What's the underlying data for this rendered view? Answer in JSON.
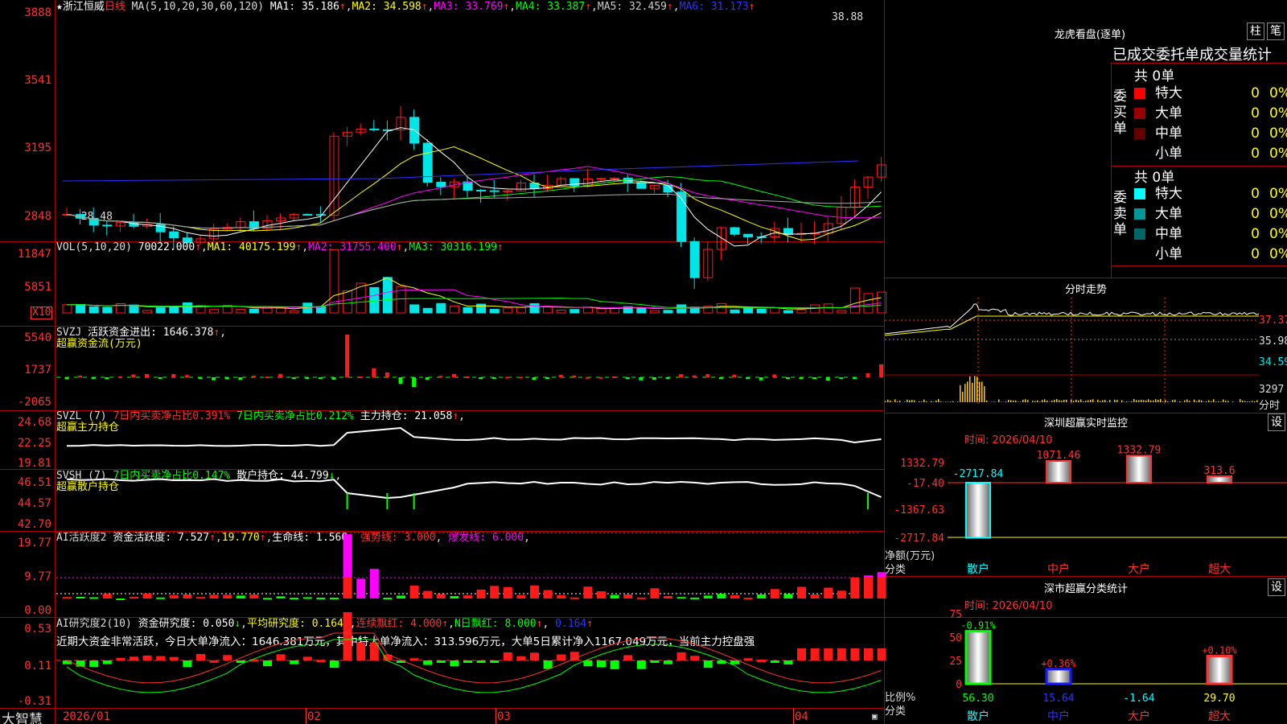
{
  "colors": {
    "up": "#ff1a1a",
    "down": "#00e6e6",
    "grid": "#aa0000",
    "yellow": "#ffff00",
    "magenta": "#ff00ff",
    "green": "#00ff00",
    "blue": "#3030ff"
  },
  "kline": {
    "title_star": "★浙江恒威",
    "period": "日线",
    "ma_label": "MA(5,10,20,30,60,120)",
    "ma1": "MA1: 35.186",
    "ma2": "MA2: 34.598",
    "ma3": "MA3: 33.769",
    "ma4": "MA4: 33.387",
    "ma5": "MA5: 32.459",
    "ma6": "MA6: 31.173",
    "arrow": "↑",
    "y_ticks": [
      "3888",
      "3541",
      "3195",
      "2848"
    ],
    "high_label": "38.88",
    "low_label": "←28.48"
  },
  "vol": {
    "label": "VOL(5,10,20)",
    "value": "70022.000",
    "ma1": "MA1: 40175.199",
    "ma2": "MA2: 31755.400",
    "ma3": "MA3: 30316.199",
    "y_ticks": [
      "11847",
      "5851"
    ],
    "unit": "X10"
  },
  "svzj": {
    "label": "SVZJ",
    "text": "活跃资金进出: 1646.378",
    "sub": "超赢资金流(万元)",
    "y_ticks": [
      "5540",
      "1737",
      "-2065"
    ]
  },
  "svzl": {
    "label": "SVZL (7)",
    "r1": "7日内买卖净占比0.391%",
    "r2": "7日内买卖净占比0.212%",
    "r3": "主力持仓: 21.058",
    "sub": "超赢主力持仓",
    "y_ticks": [
      "24.68",
      "22.25",
      "19.81"
    ]
  },
  "svsh": {
    "label": "SVSH (7)",
    "r1": "7日内买卖净占比0.147%",
    "r2": "散户持仓: 44.799",
    "sub": "超赢散户持仓",
    "y_ticks": [
      "46.51",
      "44.57",
      "42.70"
    ]
  },
  "ai1": {
    "label": "AI活跃度2",
    "t1": "资金活跃度: 7.527",
    "t2": "19.770",
    "t3": "生命线: 1.560",
    "t4": "强势线: 3.000",
    "t5": "爆发线: 6.000",
    "y_ticks": [
      "19.77",
      "9.77",
      "0.00"
    ]
  },
  "ai2": {
    "label": "AI研究度2(10)",
    "t1": "资金研究度: 0.050",
    "t2": "平均研究度: 0.164",
    "t3": "连续飘红: 4.000",
    "t4": "N日飘红: 8.000",
    "t5": "0.164",
    "summary": "近期大资金非常活跃，今日大单净流入：1646.381万元，其中特大单净流入：313.596万元，大单5日累计净入1167.049万元，当前主力控盘强",
    "y_ticks": [
      "0.53",
      "0.11",
      "-0.31"
    ]
  },
  "xaxis": {
    "brand": "大智慧",
    "dates": [
      "2026/01",
      "02",
      "03",
      "04"
    ]
  },
  "right": {
    "lhb_title": "龙虎看盘(逐单)",
    "btn_bar": "柱",
    "btn_tick": "笔",
    "stat_title": "已成交委托单成交量统计",
    "buy": {
      "side": "委买单",
      "total": "共 0单",
      "rows": [
        {
          "label": "特大",
          "v": "0",
          "p": "0%",
          "c": "#ff0000"
        },
        {
          "label": "大单",
          "v": "0",
          "p": "0%",
          "c": "#990000"
        },
        {
          "label": "中单",
          "v": "0",
          "p": "0%",
          "c": "#660000"
        },
        {
          "label": "小单",
          "v": "0",
          "p": "0%",
          "c": "#000000"
        }
      ]
    },
    "sell": {
      "side": "委卖单",
      "total": "共 0单",
      "rows": [
        {
          "label": "特大",
          "v": "0",
          "p": "0%",
          "c": "#00ffff"
        },
        {
          "label": "大单",
          "v": "0",
          "p": "0%",
          "c": "#009999"
        },
        {
          "label": "中单",
          "v": "0",
          "p": "0%",
          "c": "#006666"
        },
        {
          "label": "小单",
          "v": "0",
          "p": "0%",
          "c": "#000000"
        }
      ]
    },
    "intraday": {
      "title": "分时走势",
      "p1": "37.37",
      "p2": "35.98",
      "p3": "34.59",
      "vol": "3297",
      "unit": "分时"
    },
    "monitor": {
      "title": "深圳超赢实时监控",
      "set": "设",
      "time": "时间: 2026/04/10",
      "y_ticks": [
        "1332.79",
        "-17.40",
        "-1367.63",
        "-2717.84"
      ],
      "ylabel": "净额(万元)",
      "cat_label": "分类",
      "cats": [
        "散户",
        "中户",
        "大户",
        "超大"
      ],
      "values": [
        -2717.84,
        1071.46,
        1332.79,
        313.6
      ],
      "labels": [
        "-2717.84",
        "1071.46",
        "1332.79",
        "313.6"
      ]
    },
    "classify": {
      "title": "深市超赢分类统计",
      "set": "设",
      "time": "时间: 2026/04/10",
      "y_ticks": [
        "75",
        "50",
        "25",
        "0"
      ],
      "ylabel": "比例%",
      "cat_label": "分类",
      "cats": [
        "散户",
        "中户",
        "大户",
        "超大"
      ],
      "top_labels": [
        "-0.91%",
        "+0.36%",
        "",
        "+0.10%"
      ],
      "values": [
        56.3,
        15.64,
        -1.64,
        29.7
      ],
      "bottom_labels": [
        "56.30",
        "15.64",
        "-1.64",
        "29.70"
      ]
    }
  }
}
